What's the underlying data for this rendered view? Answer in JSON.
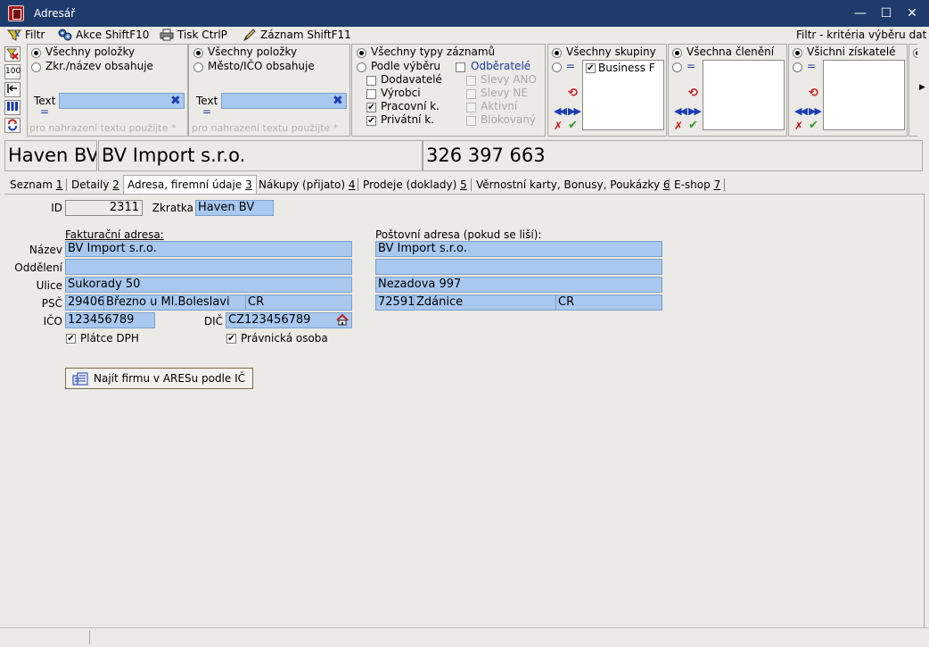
{
  "window": {
    "title": "Adresář",
    "minimize": "—",
    "maximize": "☐",
    "close": "✕"
  },
  "menu": {
    "filter": "Filtr",
    "actions": "Akce ShiftF10",
    "print": "Tisk CtrlP",
    "record": "Záznam ShiftF11",
    "right_label": "Filtr - kritéria výběru dat"
  },
  "toolbar_left": {
    "btn_100": "100"
  },
  "filters": {
    "panel1": {
      "opt_all": "Všechny položky",
      "opt_contains": "Zkr./název obsahuje",
      "text_label": "Text",
      "text_eq": "=",
      "text_value": "",
      "hint": "pro nahrazení textu použijte *"
    },
    "panel2": {
      "opt_all": "Všechny položky",
      "opt_contains": "Město/IČO obsahuje",
      "text_label": "Text",
      "text_eq": "=",
      "text_value": "",
      "hint": "pro nahrazení textu použijte *"
    },
    "panel3": {
      "opt_all": "Všechny typy záznamů",
      "opt_select": "Podle výběru",
      "odberatele": "Odběratelé",
      "dodavatele": "Dodavatelé",
      "vyrobci": "Výrobci",
      "pracovni": "Pracovní k.",
      "privatni": "Privátní k.",
      "slevy_ano": "Slevy ANO",
      "slevy_ne": "Slevy NE",
      "aktivni": "Aktivní",
      "blokovany": "Blokovaný"
    },
    "panel4": {
      "title": "Všechny skupiny",
      "eq": "=",
      "items": [
        "Business F"
      ]
    },
    "panel5": {
      "title": "Všechna členění",
      "eq": "="
    },
    "panel6": {
      "title": "Všichni získatelé",
      "eq": "="
    }
  },
  "info": {
    "short": "Haven BV",
    "name": "BV Import s.r.o.",
    "phone": "326 397 663"
  },
  "tabs": [
    {
      "label": "Seznam",
      "key": "1"
    },
    {
      "label": "Detaily",
      "key": "2"
    },
    {
      "label": "Adresa, firemní údaje",
      "key": "3"
    },
    {
      "label": "Nákupy (přijato)",
      "key": "4"
    },
    {
      "label": "Prodeje (doklady)",
      "key": "5"
    },
    {
      "label": "Věrnostní karty, Bonusy, Poukázky",
      "key": "6"
    },
    {
      "label": "E-shop",
      "key": "7"
    }
  ],
  "form": {
    "id_label": "ID",
    "id_value": "2311",
    "zkratka_label": "Zkratka",
    "zkratka_value": "Haven BV",
    "billing_header": "Fakturační adresa:",
    "postal_header": "Poštovní adresa (pokud se liší):",
    "nazev_label": "Název",
    "oddeleni_label": "Oddělení",
    "ulice_label": "Ulice",
    "psc_label": "PSČ",
    "ico_label": "IČO",
    "dic_label": "DIČ",
    "billing": {
      "nazev": "BV Import s.r.o.",
      "oddeleni": "",
      "ulice": "Sukorady 50",
      "psc": "29406",
      "mesto": "Březno u Ml.Boleslavi",
      "zeme": "CR"
    },
    "postal": {
      "nazev": "BV Import s.r.o.",
      "oddeleni": "",
      "ulice": "Nezadova 997",
      "psc": "72591",
      "mesto": "Ždánice",
      "zeme": "CR"
    },
    "ico": "123456789",
    "dic": "CZ123456789",
    "platce_dph": "Plátce DPH",
    "pravnicka": "Právnická osoba",
    "ares_button": "Najít firmu v ARESu podle IČ"
  }
}
